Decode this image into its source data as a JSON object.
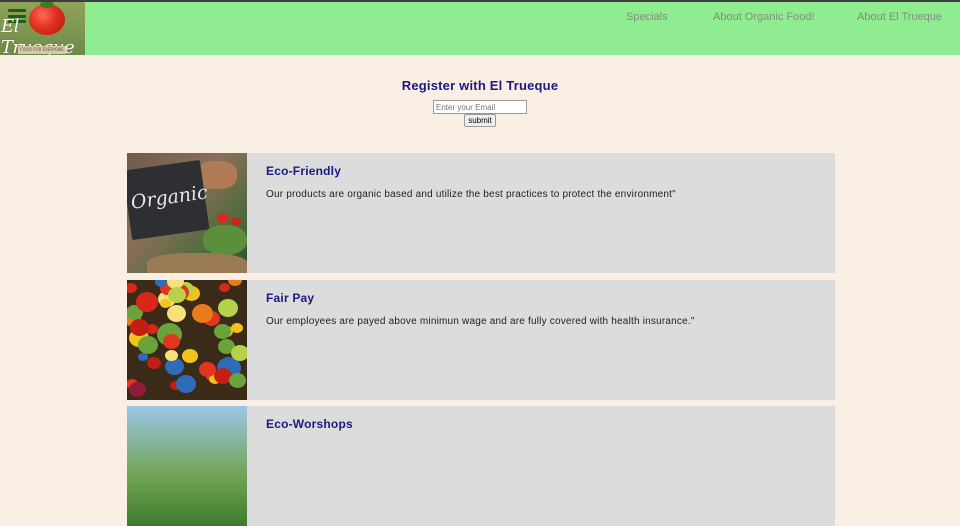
{
  "header": {
    "logo_text": "El Trueque",
    "logo_tagline": "FOOD FOR EVERYONE",
    "nav": [
      {
        "label": "Specials"
      },
      {
        "label": "About Organic Food!"
      },
      {
        "label": "About El Trueque"
      }
    ]
  },
  "register": {
    "title": "Register with El Trueque",
    "email_placeholder": "Enter your Email",
    "submit_label": "submit"
  },
  "features": [
    {
      "title": "Eco-Friendly",
      "description": "Our products are organic based and utilize the best practices to protect the environment\"",
      "photo_sign_text": "Organic"
    },
    {
      "title": "Fair Pay",
      "description": "Our employees are payed above minimun wage and are fully covered with health insurance.\""
    },
    {
      "title": "Eco-Worshops",
      "description": ""
    }
  ],
  "colors": {
    "header_bg": "#90ec90",
    "page_bg": "#faefe4",
    "card_bg": "#dcdcdc",
    "heading": "#1a1a80"
  }
}
